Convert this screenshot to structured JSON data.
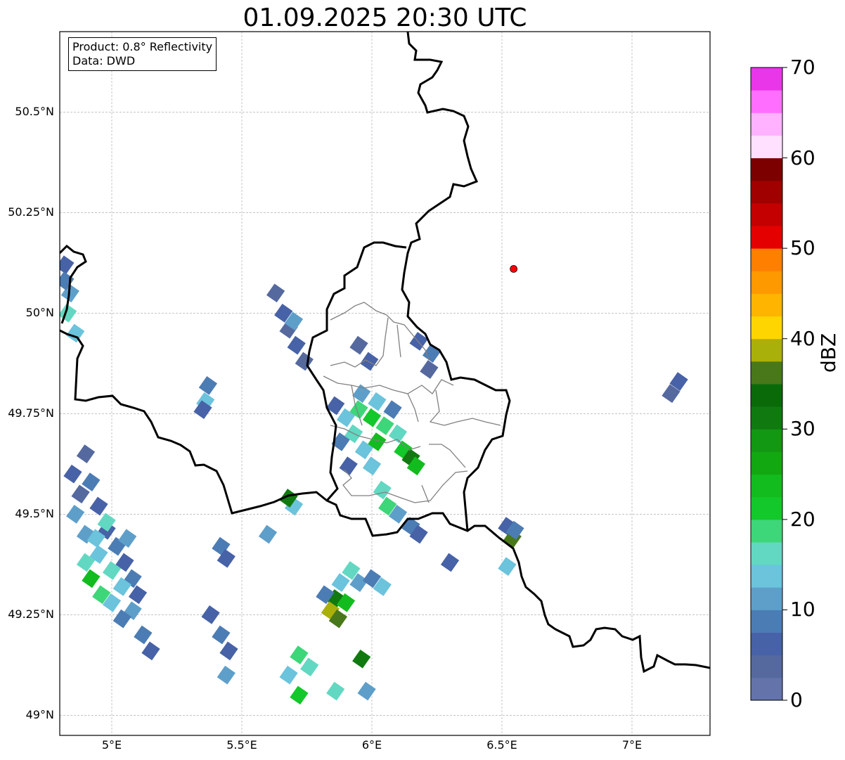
{
  "title": "01.09.2025 20:30 UTC",
  "info": {
    "product": "Product: 0.8° Reflectivity",
    "data": "Data: DWD"
  },
  "map": {
    "extent": {
      "lon_min": 4.8,
      "lon_max": 7.3,
      "lat_min": 48.95,
      "lat_max": 50.7
    },
    "lat_ticks": [
      {
        "value": 50.5,
        "label": "50.5°N"
      },
      {
        "value": 50.25,
        "label": "50.25°N"
      },
      {
        "value": 50.0,
        "label": "50°N"
      },
      {
        "value": 49.75,
        "label": "49.75°N"
      },
      {
        "value": 49.5,
        "label": "49.5°N"
      },
      {
        "value": 49.25,
        "label": "49.25°N"
      },
      {
        "value": 49.0,
        "label": "49°N"
      }
    ],
    "lon_ticks": [
      {
        "value": 5.0,
        "label": "5°E"
      },
      {
        "value": 5.5,
        "label": "5.5°E"
      },
      {
        "value": 6.0,
        "label": "6°E"
      },
      {
        "value": 6.5,
        "label": "6.5°E"
      },
      {
        "value": 7.0,
        "label": "7°E"
      }
    ],
    "marker": {
      "lon": 6.545,
      "lat": 50.11,
      "color": "#ff0000"
    },
    "colors": {
      "border": "#000000",
      "region": "#808080",
      "grid": "#b0b0b0"
    }
  },
  "colorbar": {
    "label": "dBZ",
    "min": 0,
    "max": 70,
    "ticks": [
      0,
      10,
      20,
      30,
      40,
      50,
      60,
      70
    ],
    "colors": [
      "#6473a9",
      "#55699f",
      "#4762a6",
      "#4c7cb4",
      "#5e9fca",
      "#6bc3dc",
      "#62d8c2",
      "#3dd679",
      "#12c82a",
      "#12bc1e",
      "#12a812",
      "#129812",
      "#107a10",
      "#0a6a0a",
      "#48781a",
      "#aab00a",
      "#ffd500",
      "#ffb400",
      "#ff9900",
      "#ff7f00",
      "#e40000",
      "#c40000",
      "#a00000",
      "#7c0000",
      "#ffe0ff",
      "#ffb2ff",
      "#ff6eff",
      "#e836e8"
    ]
  },
  "echoes": [
    {
      "cells": [
        [
          4.88,
          49.55,
          1
        ],
        [
          4.92,
          49.58,
          3
        ],
        [
          4.95,
          49.52,
          2
        ],
        [
          4.98,
          49.46,
          2
        ],
        [
          5.02,
          49.42,
          3
        ],
        [
          5.05,
          49.38,
          2
        ],
        [
          5.08,
          49.34,
          3
        ],
        [
          5.1,
          49.3,
          2
        ],
        [
          4.9,
          49.45,
          4
        ],
        [
          4.95,
          49.4,
          5
        ],
        [
          5.0,
          49.36,
          6
        ],
        [
          5.04,
          49.32,
          5
        ],
        [
          5.08,
          49.26,
          4
        ],
        [
          5.12,
          49.2,
          3
        ],
        [
          5.15,
          49.16,
          2
        ],
        [
          4.85,
          49.6,
          2
        ],
        [
          4.9,
          49.65,
          1
        ],
        [
          4.86,
          49.5,
          4
        ],
        [
          4.92,
          49.34,
          9
        ],
        [
          4.96,
          49.3,
          7
        ],
        [
          5.0,
          49.28,
          5
        ],
        [
          5.04,
          49.24,
          3
        ],
        [
          4.98,
          49.48,
          6
        ],
        [
          5.06,
          49.44,
          4
        ],
        [
          4.9,
          49.38,
          6
        ],
        [
          4.94,
          49.44,
          5
        ]
      ]
    },
    {
      "cells": [
        [
          4.82,
          50.12,
          2
        ],
        [
          4.84,
          50.05,
          4
        ],
        [
          4.83,
          50.0,
          6
        ],
        [
          4.86,
          49.95,
          5
        ],
        [
          4.82,
          50.08,
          3
        ]
      ]
    },
    {
      "cells": [
        [
          5.63,
          50.05,
          1
        ],
        [
          5.66,
          50.0,
          2
        ],
        [
          5.68,
          49.96,
          1
        ],
        [
          5.71,
          49.92,
          2
        ],
        [
          5.74,
          49.88,
          1
        ],
        [
          5.7,
          49.98,
          4
        ]
      ]
    },
    {
      "cells": [
        [
          5.37,
          49.82,
          3
        ],
        [
          5.36,
          49.78,
          5
        ],
        [
          5.35,
          49.76,
          2
        ]
      ]
    },
    {
      "cells": [
        [
          5.86,
          49.77,
          2
        ],
        [
          5.9,
          49.74,
          5
        ],
        [
          5.95,
          49.76,
          7
        ],
        [
          6.0,
          49.74,
          8
        ],
        [
          6.05,
          49.72,
          7
        ],
        [
          6.1,
          49.7,
          6
        ],
        [
          6.12,
          49.66,
          8
        ],
        [
          6.15,
          49.64,
          12
        ],
        [
          6.17,
          49.62,
          9
        ],
        [
          5.93,
          49.7,
          6
        ],
        [
          5.97,
          49.66,
          5
        ],
        [
          6.02,
          49.68,
          9
        ],
        [
          5.88,
          49.68,
          3
        ],
        [
          5.91,
          49.62,
          2
        ],
        [
          6.0,
          49.62,
          5
        ],
        [
          6.04,
          49.56,
          6
        ],
        [
          6.06,
          49.52,
          7
        ],
        [
          6.1,
          49.5,
          4
        ],
        [
          6.15,
          49.47,
          3
        ],
        [
          6.18,
          49.45,
          2
        ],
        [
          5.96,
          49.8,
          4
        ],
        [
          6.02,
          49.78,
          5
        ],
        [
          6.08,
          49.76,
          3
        ]
      ]
    },
    {
      "cells": [
        [
          5.7,
          49.52,
          5
        ],
        [
          5.68,
          49.54,
          12
        ]
      ]
    },
    {
      "cells": [
        [
          6.18,
          49.93,
          2
        ],
        [
          6.23,
          49.9,
          3
        ],
        [
          6.22,
          49.86,
          1
        ]
      ]
    },
    {
      "cells": [
        [
          5.95,
          49.92,
          1
        ],
        [
          5.99,
          49.88,
          2
        ]
      ]
    },
    {
      "cells": [
        [
          6.52,
          49.47,
          2
        ],
        [
          6.54,
          49.44,
          14
        ],
        [
          6.55,
          49.46,
          3
        ],
        [
          6.52,
          49.37,
          5
        ]
      ]
    },
    {
      "cells": [
        [
          5.88,
          49.33,
          5
        ],
        [
          5.86,
          49.29,
          12
        ],
        [
          5.84,
          49.26,
          15
        ],
        [
          5.87,
          49.24,
          14
        ],
        [
          5.9,
          49.28,
          9
        ],
        [
          5.92,
          49.36,
          6
        ],
        [
          5.95,
          49.33,
          4
        ],
        [
          6.0,
          49.34,
          3
        ],
        [
          6.04,
          49.32,
          5
        ],
        [
          5.82,
          49.3,
          3
        ]
      ]
    },
    {
      "cells": [
        [
          5.42,
          49.42,
          3
        ],
        [
          5.44,
          49.39,
          2
        ],
        [
          5.6,
          49.45,
          4
        ],
        [
          5.38,
          49.25,
          2
        ],
        [
          5.42,
          49.2,
          3
        ],
        [
          5.45,
          49.16,
          2
        ],
        [
          5.44,
          49.1,
          4
        ],
        [
          5.72,
          49.15,
          7
        ],
        [
          5.76,
          49.12,
          6
        ],
        [
          5.68,
          49.1,
          5
        ],
        [
          5.72,
          49.05,
          8
        ],
        [
          5.86,
          49.06,
          6
        ],
        [
          5.98,
          49.06,
          4
        ],
        [
          5.96,
          49.14,
          12
        ],
        [
          6.3,
          49.38,
          2
        ],
        [
          7.18,
          49.83,
          2
        ],
        [
          7.15,
          49.8,
          1
        ]
      ]
    }
  ]
}
